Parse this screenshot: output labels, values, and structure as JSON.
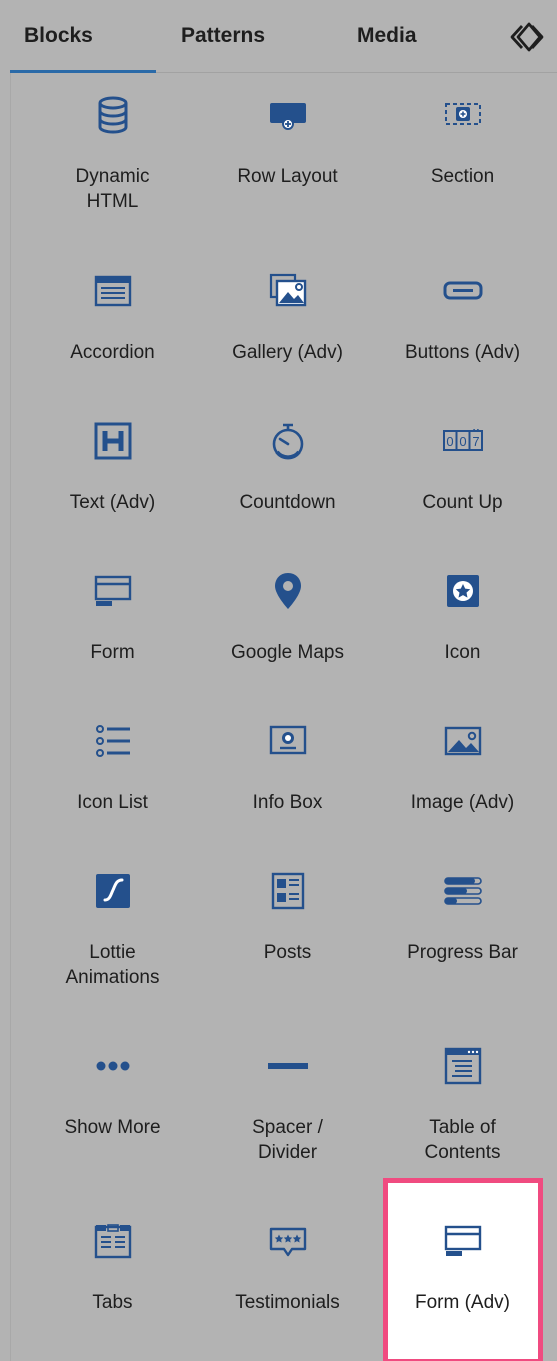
{
  "tabs": {
    "blocks": "Blocks",
    "patterns": "Patterns",
    "media": "Media"
  },
  "icon_color": "#24508c",
  "highlight_color": "#f04b80",
  "blocks": [
    {
      "label": "Dynamic\nHTML",
      "icon": "database-icon"
    },
    {
      "label": "Row Layout",
      "icon": "row-layout-icon"
    },
    {
      "label": "Section",
      "icon": "section-icon"
    },
    {
      "label": "Accordion",
      "icon": "accordion-icon"
    },
    {
      "label": "Gallery (Adv)",
      "icon": "gallery-icon"
    },
    {
      "label": "Buttons (Adv)",
      "icon": "button-icon"
    },
    {
      "label": "Text (Adv)",
      "icon": "heading-icon"
    },
    {
      "label": "Countdown",
      "icon": "stopwatch-icon"
    },
    {
      "label": "Count Up",
      "icon": "counter-icon"
    },
    {
      "label": "Form",
      "icon": "form-icon"
    },
    {
      "label": "Google Maps",
      "icon": "map-pin-icon"
    },
    {
      "label": "Icon",
      "icon": "star-icon"
    },
    {
      "label": "Icon List",
      "icon": "list-icon"
    },
    {
      "label": "Info Box",
      "icon": "info-box-icon"
    },
    {
      "label": "Image (Adv)",
      "icon": "image-icon"
    },
    {
      "label": "Lottie\nAnimations",
      "icon": "lottie-icon"
    },
    {
      "label": "Posts",
      "icon": "posts-icon"
    },
    {
      "label": "Progress Bar",
      "icon": "progress-bars-icon"
    },
    {
      "label": "Show More",
      "icon": "ellipsis-icon"
    },
    {
      "label": "Spacer /\nDivider",
      "icon": "divider-icon"
    },
    {
      "label": "Table of\nContents",
      "icon": "table-of-contents-icon"
    },
    {
      "label": "Tabs",
      "icon": "tabs-icon"
    },
    {
      "label": "Testimonials",
      "icon": "testimonial-icon"
    },
    {
      "label": "Form (Adv)",
      "icon": "form-adv-icon",
      "selected": true
    }
  ]
}
